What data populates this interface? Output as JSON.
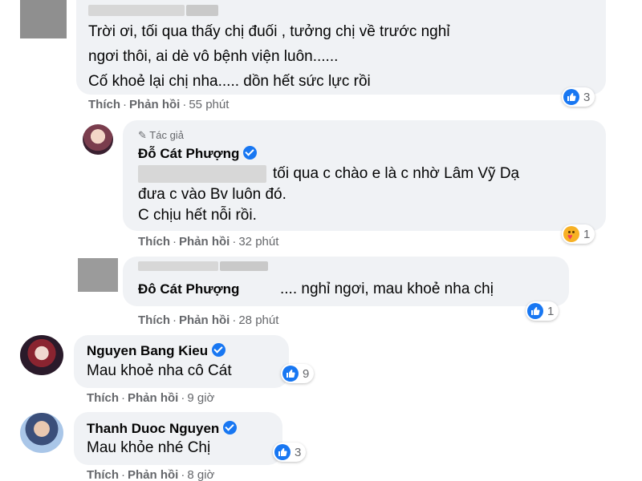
{
  "comments": [
    {
      "lines": [
        "Trời ơi, tối qua thấy chị đuối , tưởng chị về trước nghỉ",
        "ngơi thôi, ai dè vô bệnh viện luôn......",
        "Cố khoẻ lại chị nha..... dồn hết sức lực rồi"
      ],
      "like": "Thích",
      "reply": "Phản hồi",
      "time": "55 phút",
      "reaction_count": "3"
    },
    {
      "author_tag": "Tác giả",
      "name": "Đỗ Cát Phượng",
      "lines": [
        "tối qua c chào e là c nhờ Lâm Vỹ Dạ",
        "đưa c vào Bv luôn đó.",
        "C chịu hết nỗi rồi."
      ],
      "like": "Thích",
      "reply": "Phản hồi",
      "time": "32 phút",
      "reaction_count": "1"
    },
    {
      "tag": "Đô Cát Phượng",
      "text": ".... nghỉ ngơi, mau khoẻ nha chị",
      "like": "Thích",
      "reply": "Phản hồi",
      "time": "28 phút",
      "reaction_count": "1"
    },
    {
      "name": "Nguyen Bang Kieu",
      "text": "Mau khoẻ nha cô Cát",
      "like": "Thích",
      "reply": "Phản hồi",
      "time": "9 giờ",
      "reaction_count": "9"
    },
    {
      "name": "Thanh Duoc Nguyen",
      "text": "Mau khỏe nhé Chị",
      "like": "Thích",
      "reply": "Phản hồi",
      "time": "8 giờ",
      "reaction_count": "3"
    }
  ],
  "icons": {
    "like": "like-icon",
    "care": "care-icon",
    "verified": "verified-badge-icon",
    "pen": "pen-icon"
  },
  "colors": {
    "bubble": "#f0f2f5",
    "like_blue": "#1877f2",
    "meta_gray": "#65676b"
  }
}
